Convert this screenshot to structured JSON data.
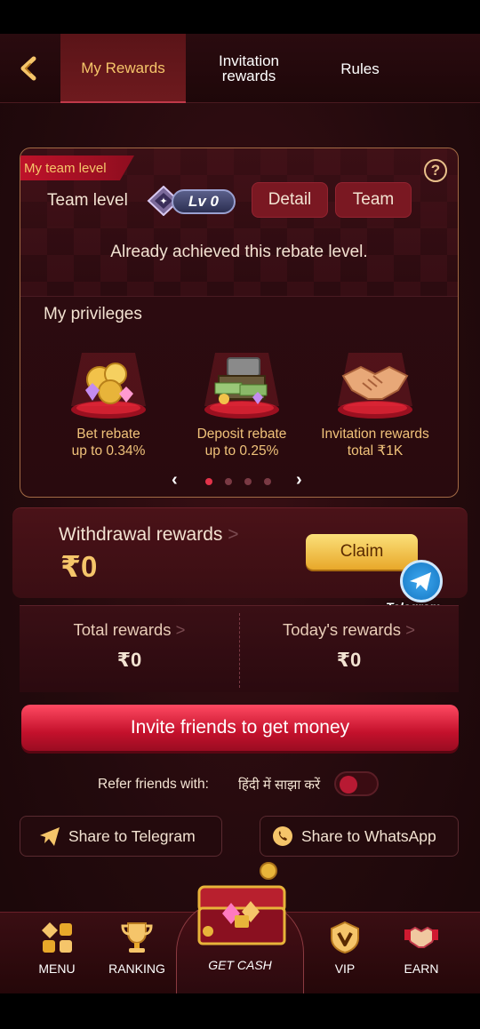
{
  "header": {
    "tabs": [
      {
        "label": "My Rewards",
        "active": true
      },
      {
        "label_line1": "Invitation",
        "label_line2": "rewards",
        "active": false
      },
      {
        "label": "Rules",
        "active": false
      }
    ]
  },
  "team_card": {
    "tag": "My team level",
    "team_level_label": "Team level",
    "level_badge": "Lv 0",
    "detail_button": "Detail",
    "team_button": "Team",
    "achieved_text": "Already achieved this rebate level.",
    "privileges_title": "My privileges",
    "privileges": [
      {
        "line1": "Bet rebate",
        "line2": "up to 0.34%",
        "icon": "coins-gems-icon"
      },
      {
        "line1": "Deposit rebate",
        "line2": "up to 0.25%",
        "icon": "money-chest-icon"
      },
      {
        "line1": "Invitation rewards",
        "line2": "total ₹1K",
        "icon": "handshake-icon"
      }
    ],
    "pager": {
      "pages": 4,
      "current": 1
    }
  },
  "withdrawal": {
    "title": "Withdrawal rewards",
    "arrow": ">",
    "amount": "₹0",
    "claim_button": "Claim"
  },
  "telegram_float": {
    "label": "Telegram"
  },
  "totals": {
    "total_label": "Total rewards",
    "total_value": "₹0",
    "today_label": "Today's rewards",
    "today_value": "₹0",
    "arrow": ">"
  },
  "invite_button": "Invite friends to get money",
  "refer": {
    "label": "Refer friends with:",
    "language": "हिंदी में साझा करें",
    "toggle_on": false
  },
  "share": {
    "telegram": "Share to Telegram",
    "whatsapp": "Share to WhatsApp"
  },
  "nav": {
    "menu": "MENU",
    "ranking": "RANKING",
    "get_cash": "GET CASH",
    "vip": "VIP",
    "earn": "EARN"
  },
  "colors": {
    "accent_gold": "#f5c56a",
    "accent_red": "#c4112c",
    "background": "#230a0d"
  }
}
